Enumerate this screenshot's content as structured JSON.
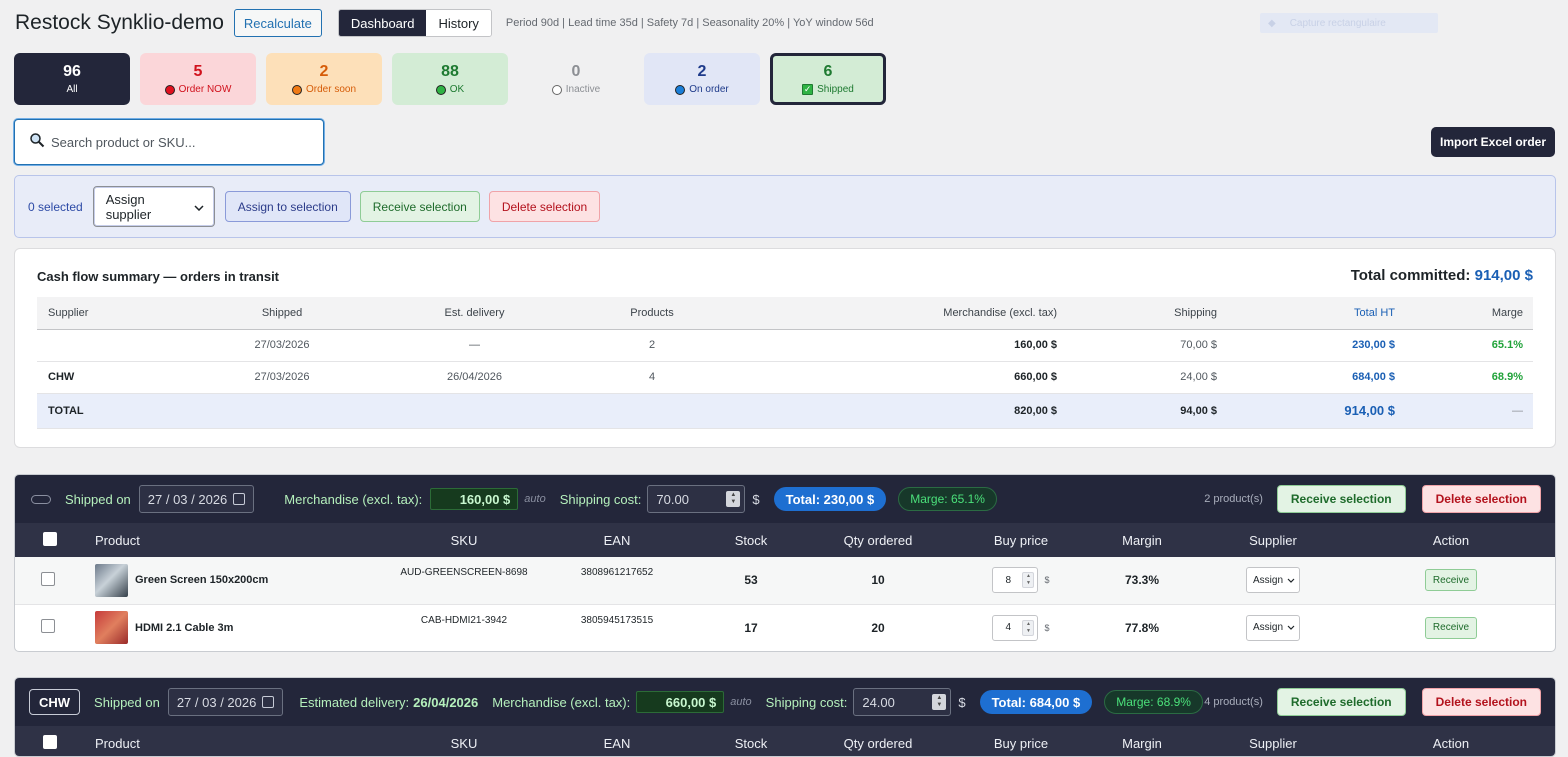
{
  "header": {
    "title": "Restock Synklio-demo",
    "recalculate": "Recalculate",
    "tabs": [
      {
        "label": "Dashboard",
        "active": true
      },
      {
        "label": "History",
        "active": false
      }
    ],
    "meta": "Period 90d | Lead time 35d | Safety 7d | Seasonality 20% | YoY window 56d",
    "capture": "Capture rectangulaire"
  },
  "stats": [
    {
      "value": "96",
      "label": "All"
    },
    {
      "value": "5",
      "label": "Order NOW"
    },
    {
      "value": "2",
      "label": "Order soon"
    },
    {
      "value": "88",
      "label": "OK"
    },
    {
      "value": "0",
      "label": "Inactive"
    },
    {
      "value": "2",
      "label": "On order"
    },
    {
      "value": "6",
      "label": "Shipped",
      "active": true
    }
  ],
  "search": {
    "placeholder": "Search product or SKU..."
  },
  "import_button": "Import Excel order",
  "bulk": {
    "selected": "0 selected",
    "supplier_select": "Assign supplier",
    "assign": "Assign to selection",
    "receive": "Receive selection",
    "delete": "Delete selection"
  },
  "summary": {
    "title": "Cash flow summary — orders in transit",
    "total_label": "Total committed:",
    "total_value": "914,00 $",
    "columns": [
      "Supplier",
      "Shipped",
      "Est. delivery",
      "Products",
      "Merchandise (excl. tax)",
      "Shipping",
      "Total HT",
      "Marge"
    ],
    "rows": [
      [
        "",
        "27/03/2026",
        "—",
        "2",
        "160,00 $",
        "70,00 $",
        "230,00 $",
        "65.1%"
      ],
      [
        "CHW",
        "27/03/2026",
        "26/04/2026",
        "4",
        "660,00 $",
        "24,00 $",
        "684,00 $",
        "68.9%"
      ]
    ],
    "total_row": [
      "TOTAL",
      "",
      "",
      "",
      "820,00 $",
      "94,00 $",
      "914,00 $",
      "—"
    ]
  },
  "shipments": [
    {
      "supplier": "",
      "shipped_label": "Shipped on",
      "shipped_date": "27 / 03 / 2026",
      "merch_label": "Merchandise (excl. tax):",
      "merch_value": "160,00 $",
      "auto": "auto",
      "shipping_label": "Shipping cost:",
      "shipping_value": "70.00",
      "currency": "$",
      "total": "Total: 230,00 $",
      "marge": "Marge: 65.1%",
      "count": "2 product(s)",
      "receive": "Receive selection",
      "delete": "Delete selection",
      "columns": [
        "Product",
        "SKU",
        "EAN",
        "Stock",
        "Qty ordered",
        "Buy price",
        "Margin",
        "Supplier",
        "Action"
      ],
      "rows": [
        {
          "name": "Green Screen 150x200cm",
          "sku": "AUD-GREENSCREEN-8698",
          "ean": "3808961217652",
          "stock": "53",
          "qty": "10",
          "price": "8",
          "cur": "$",
          "margin": "73.3%",
          "supplier": "Assign",
          "action": "Receive"
        },
        {
          "name": "HDMI 2.1 Cable 3m",
          "sku": "CAB-HDMI21-3942",
          "ean": "3805945173515",
          "stock": "17",
          "qty": "20",
          "price": "4",
          "cur": "$",
          "margin": "77.8%",
          "supplier": "Assign",
          "action": "Receive"
        }
      ]
    },
    {
      "supplier": "CHW",
      "shipped_label": "Shipped on",
      "shipped_date": "27 / 03 / 2026",
      "est_label": "Estimated delivery:",
      "est_value": "26/04/2026",
      "merch_label": "Merchandise (excl. tax):",
      "merch_value": "660,00 $",
      "auto": "auto",
      "shipping_label": "Shipping cost:",
      "shipping_value": "24.00",
      "currency": "$",
      "total": "Total: 684,00 $",
      "marge": "Marge: 68.9%",
      "count": "4 product(s)",
      "receive": "Receive selection",
      "delete": "Delete selection",
      "columns": [
        "Product",
        "SKU",
        "EAN",
        "Stock",
        "Qty ordered",
        "Buy price",
        "Margin",
        "Supplier",
        "Action"
      ]
    }
  ]
}
